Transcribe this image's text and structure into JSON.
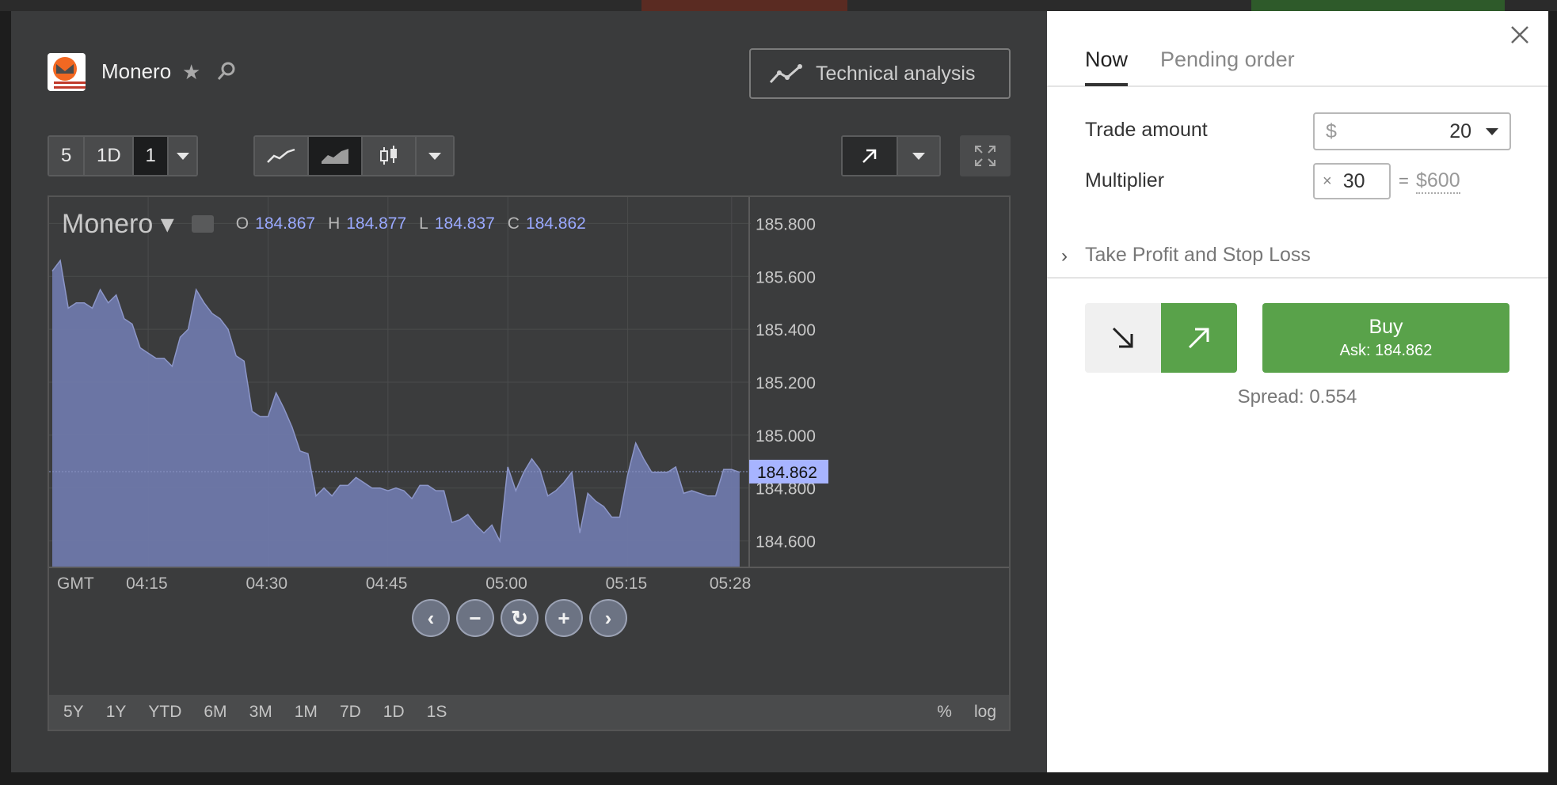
{
  "instrument": {
    "name": "Monero",
    "symbol": "Monero",
    "ohlc": [
      {
        "key": "O",
        "value": "184.867"
      },
      {
        "key": "H",
        "value": "184.877"
      },
      {
        "key": "L",
        "value": "184.837"
      },
      {
        "key": "C",
        "value": "184.862"
      }
    ]
  },
  "header": {
    "technical_analysis_label": "Technical analysis"
  },
  "toolbar": {
    "interval_buttons": [
      "5",
      "1D",
      "1"
    ],
    "active_interval_index": 2
  },
  "colors": {
    "accent_green": "#59a24a",
    "chart_fill": "#6e78aa",
    "price_label": "#a7b4ff"
  },
  "chart_data": {
    "type": "area",
    "ylim": [
      184.5,
      185.9
    ],
    "y_ticks": [
      "185.800",
      "185.600",
      "185.400",
      "185.200",
      "185.000",
      "184.800",
      "184.600"
    ],
    "y_tick_values": [
      185.8,
      185.6,
      185.4,
      185.2,
      185.0,
      184.8,
      184.6
    ],
    "x_ticks": [
      "GMT",
      "04:15",
      "04:30",
      "04:45",
      "05:00",
      "05:15",
      "05:28"
    ],
    "x_tick_values": [
      0,
      12,
      27,
      42,
      57,
      72,
      85
    ],
    "current_price": "184.862",
    "current_value": 184.862,
    "x": [
      0,
      1,
      2,
      3,
      4,
      5,
      6,
      7,
      8,
      9,
      10,
      11,
      12,
      13,
      14,
      15,
      16,
      17,
      18,
      19,
      20,
      21,
      22,
      23,
      24,
      25,
      26,
      27,
      28,
      29,
      30,
      31,
      32,
      33,
      34,
      35,
      36,
      37,
      38,
      39,
      40,
      41,
      42,
      43,
      44,
      45,
      46,
      47,
      48,
      49,
      50,
      51,
      52,
      53,
      54,
      55,
      56,
      57,
      58,
      59,
      60,
      61,
      62,
      63,
      64,
      65,
      66,
      67,
      68,
      69,
      70,
      71,
      72,
      73,
      74,
      75,
      76,
      77,
      78,
      79,
      80,
      81,
      82,
      83,
      84,
      85,
      86
    ],
    "values": [
      185.62,
      185.66,
      185.48,
      185.5,
      185.5,
      185.48,
      185.55,
      185.5,
      185.53,
      185.44,
      185.42,
      185.33,
      185.31,
      185.29,
      185.29,
      185.26,
      185.37,
      185.4,
      185.55,
      185.5,
      185.46,
      185.44,
      185.4,
      185.3,
      185.28,
      185.09,
      185.07,
      185.07,
      185.16,
      185.1,
      185.03,
      184.94,
      184.93,
      184.77,
      184.8,
      184.77,
      184.81,
      184.81,
      184.84,
      184.82,
      184.8,
      184.8,
      184.79,
      184.8,
      184.79,
      184.76,
      184.81,
      184.81,
      184.79,
      184.79,
      184.67,
      184.68,
      184.7,
      184.66,
      184.63,
      184.66,
      184.6,
      184.88,
      184.79,
      184.86,
      184.91,
      184.87,
      184.77,
      184.79,
      184.82,
      184.86,
      184.63,
      184.78,
      184.75,
      184.73,
      184.69,
      184.69,
      184.85,
      184.97,
      184.91,
      184.86,
      184.86,
      184.86,
      184.88,
      184.78,
      184.79,
      184.78,
      184.77,
      184.77,
      184.87,
      184.87,
      184.86
    ]
  },
  "zoom_controls": [
    "‹",
    "−",
    "↻",
    "+",
    "›"
  ],
  "time_ranges": [
    "5Y",
    "1Y",
    "YTD",
    "6M",
    "3M",
    "1M",
    "7D",
    "1D",
    "1S"
  ],
  "scale_options": [
    "%",
    "log"
  ],
  "order": {
    "tabs": [
      "Now",
      "Pending order"
    ],
    "trade_amount_label": "Trade amount",
    "currency_symbol": "$",
    "trade_amount_value": "20",
    "multiplier_label": "Multiplier",
    "multiplier_symbol": "×",
    "multiplier_value": "30",
    "equals": "=",
    "total": "$600",
    "tp_sl_label": "Take Profit and Stop Loss",
    "buy_label": "Buy",
    "ask_label": "Ask: 184.862",
    "spread_label": "Spread: 0.554"
  }
}
